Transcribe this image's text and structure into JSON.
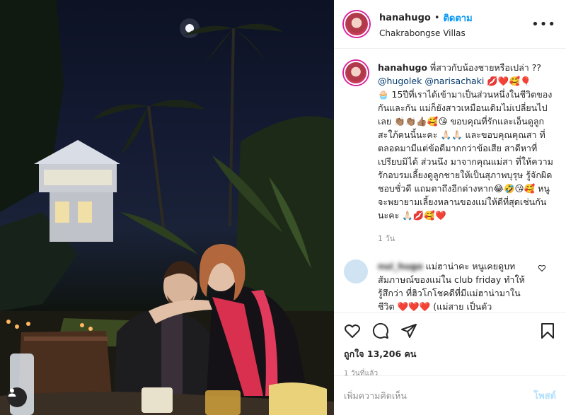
{
  "post": {
    "username": "hanahugo",
    "dot": "•",
    "follow_label": "ติดตาม",
    "location": "Chakrabongse Villas",
    "more_icon": "more-options-icon",
    "more_label": "•••"
  },
  "caption": {
    "username": "hanahugo",
    "lines": [
      "พี่สาวกับน้องชายหรือเปล่า ?? @hugolek @narisachaki 💋❤️🥰🎈",
      "🧁 15ปีที่เราได้เข้ามาเป็นส่วนหนึ่งในชีวิต ของกันและกัน แม่ก็ยังสาวเหมือนเดิมไม่เปลี่ยนไปเลย 👏🏽👏🏽👍🏽🥰😘 ขอบคุณที่รักและเอ็นดูลูกสะใภ้คนนี้นะคะ 🙏🏻🙏🏻 และขอบคุณคุณสา ที่ตลอดมามีแต่ข้อดีมากกว่าข้อเสีย สาดีหาที่เปรียบมิได้ ส่วนนึง มาจากคุณแม่สา ที่ให้ความรักอบรมเลี้ยงดูลูกชายให้เป็นสุภาพบุรุษ รู้จักผิดชอบชั่วดี แถมตาถึงอีกต่างหาก😂🤣😘🥰 หนูจะพยายามเลี้ยงหลานของแม่ให้ดีที่สุดเช่นกันนะคะ 🙏🏻💋🥰❤️"
    ],
    "mentions": [
      "@hugolek",
      "@narisachaki"
    ],
    "first_text": "พี่สาวกับน้องชายหรือเปล่า ??",
    "after_mentions": " 💋❤️🥰🎈",
    "body": "🧁 15ปีที่เราได้เข้ามาเป็นส่วนหนึ่งในชีวิตของกันและกัน แม่ก็ยังสาวเหมือนเดิมไม่เปลี่ยนไปเลย 👏🏽👏🏽👍🏽🥰😘 ขอบคุณที่รักและเอ็นดูลูกสะใภ้คนนี้นะคะ 🙏🏻🙏🏻 และขอบคุณคุณสา ที่ตลอดมามีแต่ข้อดีมากกว่าข้อเสีย สาดีหาที่เปรียบมิได้ ส่วนนึง มาจากคุณแม่สา ที่ให้ความรักอบรมเลี้ยงดูลูกชายให้เป็นสุภาพบุรุษ รู้จักผิดชอบชั่วดี แถมตาถึงอีกต่างหาก😂🤣😘🥰 หนูจะพยายามเลี้ยงหลานของแม่ให้ดีที่สุดเช่นกันนะคะ 🙏🏻💋🥰❤️",
    "time": "1 วัน"
  },
  "comment": {
    "username": "nui_hugo",
    "text": "แม่ฮาน่าคะ หนูเคยดูบทสัมภาษณ์ของแม่ใน club friday ทำให้รู้สึกว่า ที่ฮิวโกโชคดีที่มีแม่ฮาน่ามาในชีวิต ❤️❤️❤️ (แม่สาย เป็นตัว"
  },
  "actions": {
    "like_icon": "heart-icon",
    "comment_icon": "comment-icon",
    "share_icon": "share-icon",
    "save_icon": "bookmark-icon",
    "likes_text": "ถูกใจ 13,206 คน",
    "date": "1 วันที่แล้ว"
  },
  "add_comment": {
    "placeholder": "เพิ่มความคิดเห็น",
    "post_label": "โพสต์"
  },
  "colors": {
    "link": "#0095f6",
    "mention": "#00376b",
    "muted": "#8e8e8e",
    "post_disabled": "#b2dffc"
  }
}
